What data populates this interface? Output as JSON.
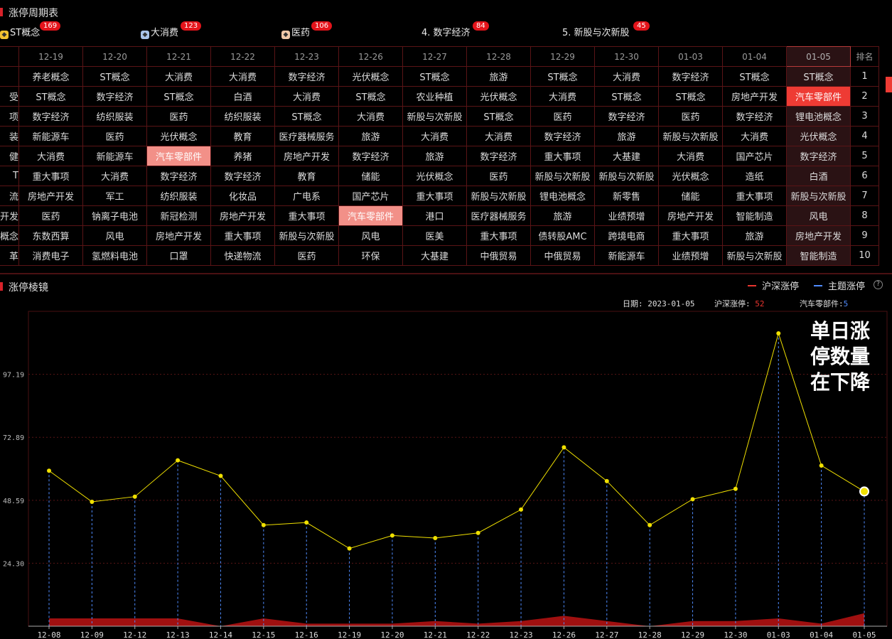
{
  "header": {
    "title": "涨停周期表"
  },
  "tabs": [
    {
      "label": "ST概念",
      "badge": "169",
      "icon": "gold-cube-icon"
    },
    {
      "label": "大消费",
      "badge": "123",
      "icon": "blue-cube-icon"
    },
    {
      "label": "医药",
      "badge": "106",
      "icon": "orange-cube-icon"
    },
    {
      "label": "4. 数字经济",
      "badge": "84",
      "icon": ""
    },
    {
      "label": "5. 新股与次新股",
      "badge": "45",
      "icon": ""
    }
  ],
  "table": {
    "columns": [
      "12-19",
      "12-20",
      "12-21",
      "12-22",
      "12-23",
      "12-26",
      "12-27",
      "12-28",
      "12-29",
      "12-30",
      "01-03",
      "01-04",
      "01-05"
    ],
    "rank_header": "排名",
    "first_col": [
      "",
      "受",
      "项",
      "装",
      "健",
      "T",
      "流",
      "开发",
      "概念",
      "革"
    ],
    "rows": [
      [
        "养老概念",
        "ST概念",
        "大消费",
        "大消费",
        "数字经济",
        "光伏概念",
        "ST概念",
        "旅游",
        "ST概念",
        "大消费",
        "数字经济",
        "ST概念",
        "ST概念",
        "1"
      ],
      [
        "ST概念",
        "数字经济",
        "ST概念",
        "白酒",
        "大消费",
        "ST概念",
        "农业种植",
        "光伏概念",
        "大消费",
        "ST概念",
        "ST概念",
        "房地产开发",
        "汽车零部件",
        "2"
      ],
      [
        "数字经济",
        "纺织服装",
        "医药",
        "纺织服装",
        "ST概念",
        "大消费",
        "新股与次新股",
        "ST概念",
        "医药",
        "数字经济",
        "医药",
        "数字经济",
        "锂电池概念",
        "3"
      ],
      [
        "新能源车",
        "医药",
        "光伏概念",
        "教育",
        "医疗器械服务",
        "旅游",
        "大消费",
        "大消费",
        "数字经济",
        "旅游",
        "新股与次新股",
        "大消费",
        "光伏概念",
        "4"
      ],
      [
        "大消费",
        "新能源车",
        "汽车零部件",
        "养猪",
        "房地产开发",
        "数字经济",
        "旅游",
        "数字经济",
        "重大事项",
        "大基建",
        "大消费",
        "国产芯片",
        "数字经济",
        "5"
      ],
      [
        "重大事项",
        "大消费",
        "数字经济",
        "数字经济",
        "教育",
        "储能",
        "光伏概念",
        "医药",
        "新股与次新股",
        "新股与次新股",
        "光伏概念",
        "造纸",
        "白酒",
        "6"
      ],
      [
        "房地产开发",
        "军工",
        "纺织服装",
        "化妆品",
        "广电系",
        "国产芯片",
        "重大事项",
        "新股与次新股",
        "锂电池概念",
        "新零售",
        "储能",
        "重大事项",
        "新股与次新股",
        "7"
      ],
      [
        "医药",
        "钠离子电池",
        "新冠检测",
        "房地产开发",
        "重大事项",
        "汽车零部件",
        "港口",
        "医疗器械服务",
        "旅游",
        "业绩预增",
        "房地产开发",
        "智能制造",
        "风电",
        "8"
      ],
      [
        "东数西算",
        "风电",
        "房地产开发",
        "重大事项",
        "新股与次新股",
        "风电",
        "医美",
        "重大事项",
        "债转股AMC",
        "跨境电商",
        "重大事项",
        "旅游",
        "房地产开发",
        "9"
      ],
      [
        "消费电子",
        "氢燃料电池",
        "口罩",
        "快递物流",
        "医药",
        "环保",
        "大基建",
        "中俄贸易",
        "中俄贸易",
        "新能源车",
        "业绩预增",
        "新股与次新股",
        "智能制造",
        "10"
      ]
    ]
  },
  "chart_header": {
    "title": "涨停棱镜",
    "legend_a": "沪深涨停",
    "legend_b": "主题涨停"
  },
  "info": {
    "date_label": "日期:",
    "date": "2023-01-05",
    "a_label": "沪深涨停:",
    "a_value": "52",
    "b_label": "汽车零部件:",
    "b_value": "5"
  },
  "annotation": "单日涨停数量在下降",
  "chart_data": {
    "type": "line",
    "x": [
      "12-08",
      "12-09",
      "12-12",
      "12-13",
      "12-14",
      "12-15",
      "12-16",
      "12-19",
      "12-20",
      "12-21",
      "12-22",
      "12-23",
      "12-26",
      "12-27",
      "12-28",
      "12-29",
      "12-30",
      "01-03",
      "01-04",
      "01-05"
    ],
    "series": [
      {
        "name": "沪深涨停",
        "color": "#f0e000",
        "values": [
          60,
          48,
          50,
          64,
          58,
          39,
          40,
          30,
          35,
          34,
          36,
          45,
          69,
          56,
          39,
          49,
          53,
          113,
          62,
          52
        ]
      },
      {
        "name": "主题涨停",
        "color": "#a01010",
        "values": [
          3,
          3,
          3,
          3,
          0,
          3,
          1,
          1,
          1,
          2,
          1,
          2,
          4,
          2,
          0,
          2,
          2,
          3,
          1,
          5
        ]
      }
    ],
    "yticks": [
      24.3,
      48.59,
      72.89,
      97.19
    ],
    "ylim": [
      0,
      121.5
    ],
    "grid": true
  }
}
